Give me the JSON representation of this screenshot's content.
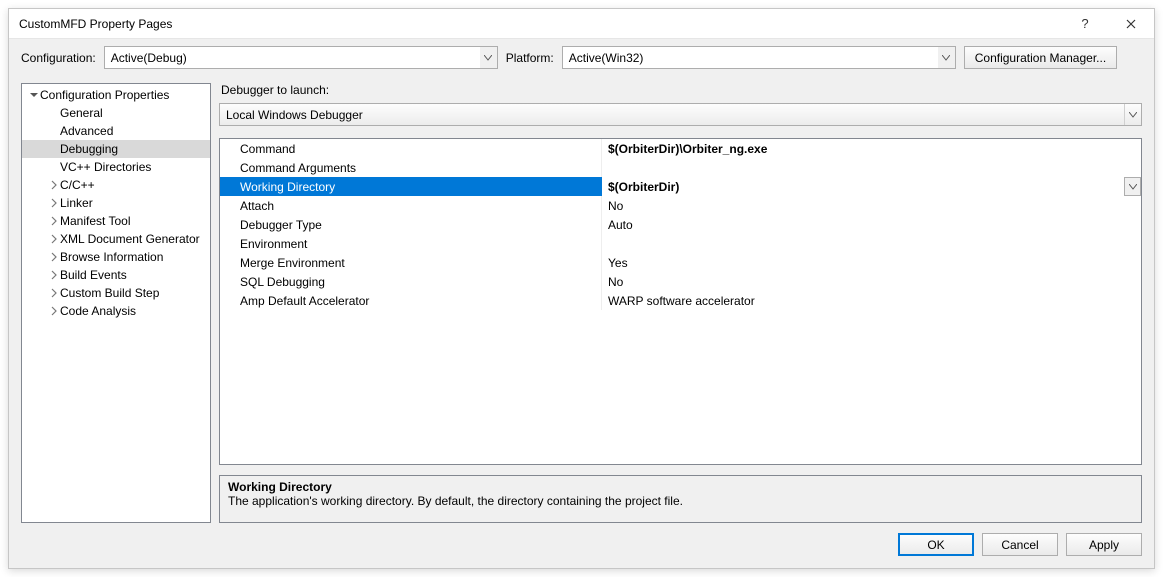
{
  "window": {
    "title": "CustomMFD Property Pages"
  },
  "configRow": {
    "configLabel": "Configuration:",
    "configValue": "Active(Debug)",
    "platformLabel": "Platform:",
    "platformValue": "Active(Win32)",
    "managerBtn": "Configuration Manager..."
  },
  "tree": {
    "root": "Configuration Properties",
    "items": [
      {
        "label": "General"
      },
      {
        "label": "Advanced"
      },
      {
        "label": "Debugging",
        "selected": true
      },
      {
        "label": "VC++ Directories"
      },
      {
        "label": "C/C++",
        "expandable": true
      },
      {
        "label": "Linker",
        "expandable": true
      },
      {
        "label": "Manifest Tool",
        "expandable": true
      },
      {
        "label": "XML Document Generator",
        "expandable": true
      },
      {
        "label": "Browse Information",
        "expandable": true
      },
      {
        "label": "Build Events",
        "expandable": true
      },
      {
        "label": "Custom Build Step",
        "expandable": true
      },
      {
        "label": "Code Analysis",
        "expandable": true
      }
    ]
  },
  "right": {
    "launcherLabel": "Debugger to launch:",
    "launcherValue": "Local Windows Debugger",
    "rows": [
      {
        "name": "Command",
        "value": "$(OrbiterDir)\\Orbiter_ng.exe",
        "bold": true
      },
      {
        "name": "Command Arguments",
        "value": ""
      },
      {
        "name": "Working Directory",
        "value": "$(OrbiterDir)",
        "selected": true,
        "dropdown": true
      },
      {
        "name": "Attach",
        "value": "No"
      },
      {
        "name": "Debugger Type",
        "value": "Auto"
      },
      {
        "name": "Environment",
        "value": ""
      },
      {
        "name": "Merge Environment",
        "value": "Yes"
      },
      {
        "name": "SQL Debugging",
        "value": "No"
      },
      {
        "name": "Amp Default Accelerator",
        "value": "WARP software accelerator"
      }
    ],
    "helpTitle": "Working Directory",
    "helpText": "The application's working directory. By default, the directory containing the project file."
  },
  "buttons": {
    "ok": "OK",
    "cancel": "Cancel",
    "apply": "Apply"
  }
}
